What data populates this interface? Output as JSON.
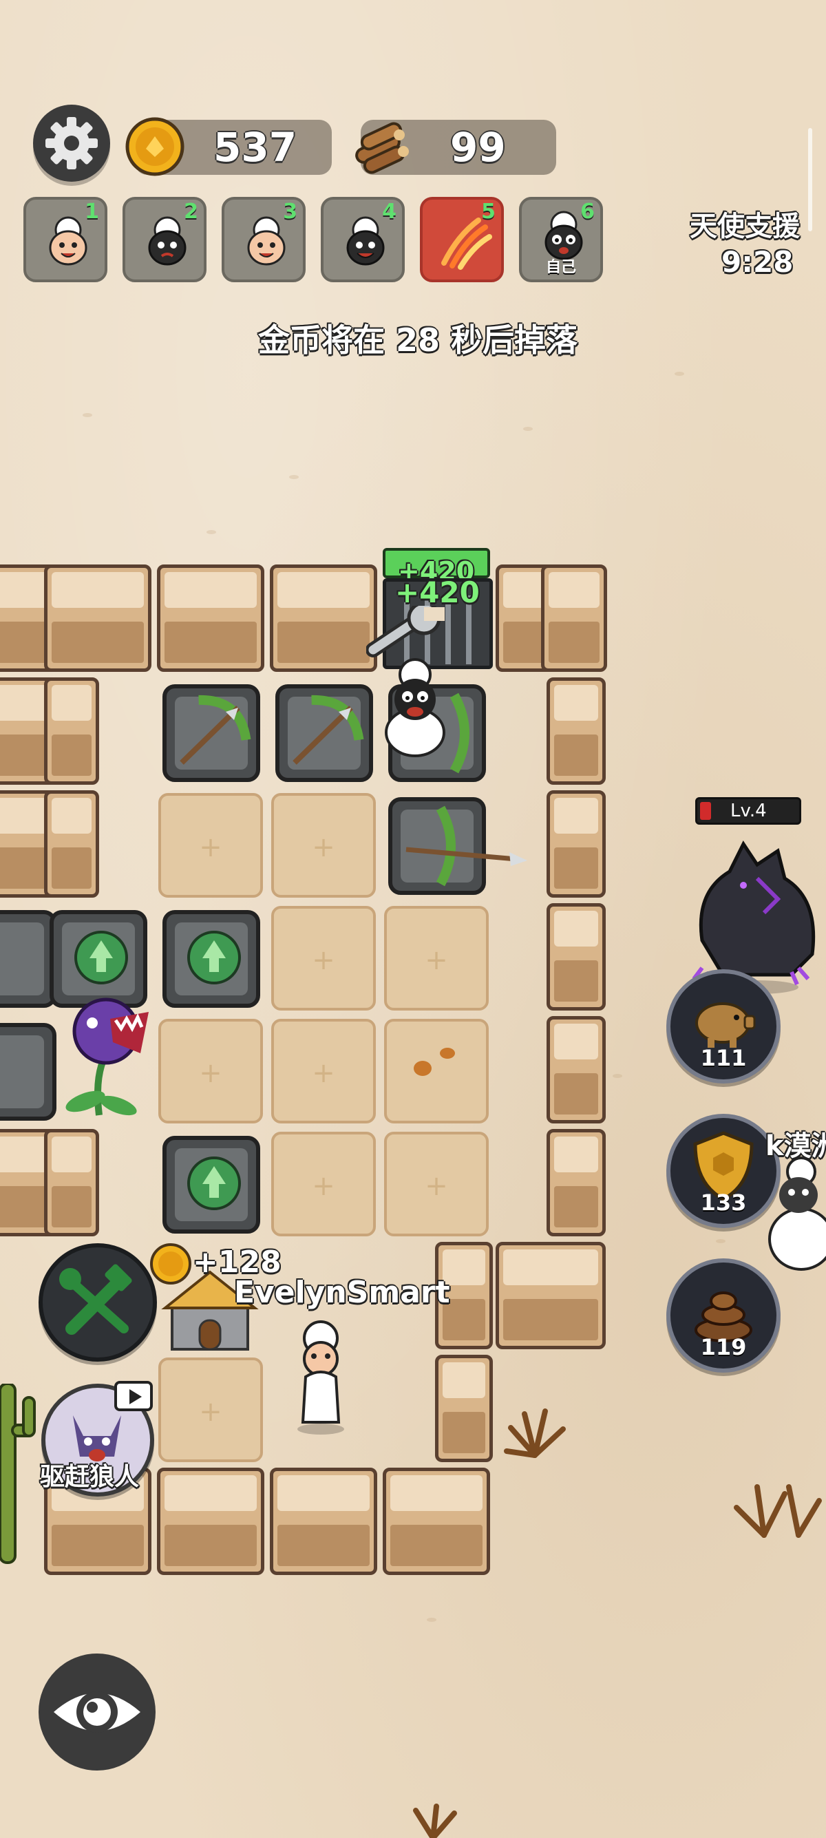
{
  "hud": {
    "gold": "537",
    "wood": "99",
    "angel_support_label": "天使支援",
    "angel_support_timer": "9:28"
  },
  "slots": [
    {
      "num": "1",
      "kind": "white-sheep"
    },
    {
      "num": "2",
      "kind": "black-sheep"
    },
    {
      "num": "3",
      "kind": "white-sheep"
    },
    {
      "num": "4",
      "kind": "black-sheep"
    },
    {
      "num": "5",
      "kind": "claw",
      "active": true
    },
    {
      "num": "6",
      "kind": "black-sheep",
      "self_label": "自己"
    }
  ],
  "notice": "金币将在 28 秒后掉落",
  "board": {
    "gate_popup_1": "+420",
    "gate_popup_2": "+420",
    "hut_popup": "+128",
    "player_name": "EvelynSmart"
  },
  "enemy": {
    "level": "Lv.4"
  },
  "side_buttons": [
    {
      "icon": "piggy-bank-icon",
      "count": "111"
    },
    {
      "icon": "shield-icon",
      "count": "133"
    },
    {
      "icon": "poop-icon",
      "count": "119"
    }
  ],
  "partial_label": "k漠洲",
  "drive_wolf_label": "驱赶狼人"
}
